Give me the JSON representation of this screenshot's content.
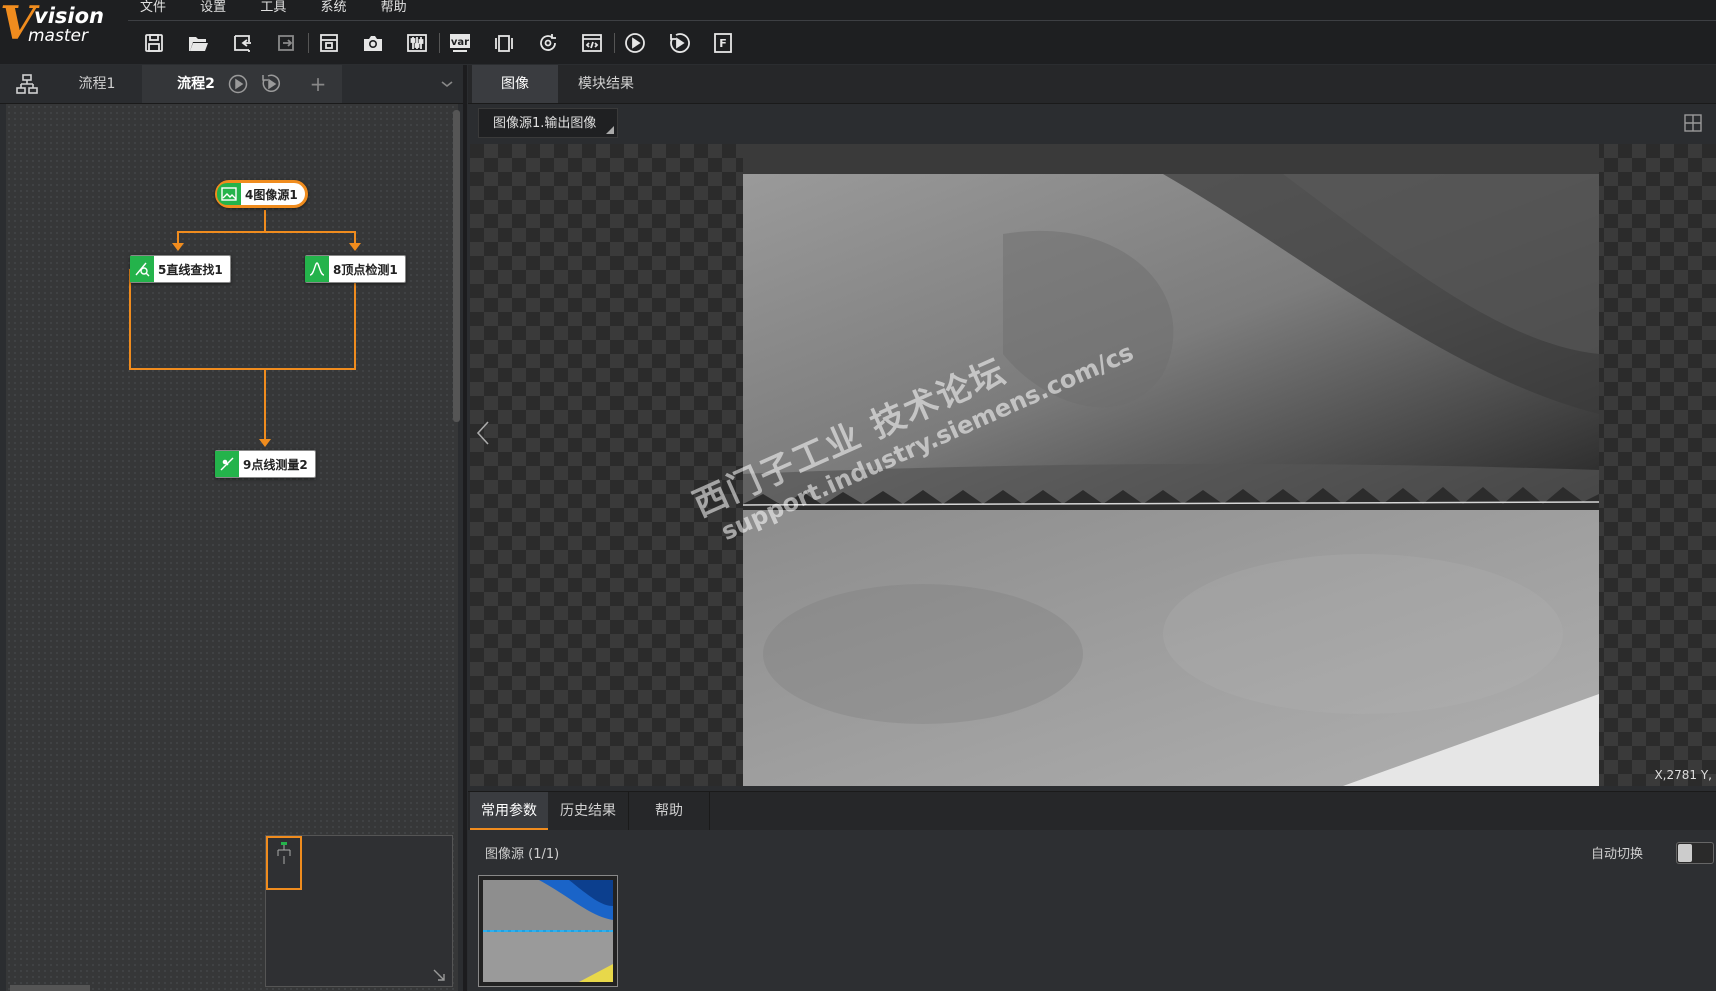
{
  "app": {
    "logo_mark": "V",
    "logo_line1": "vision",
    "logo_line2": "master"
  },
  "menu": [
    "文件",
    "设置",
    "工具",
    "系统",
    "帮助"
  ],
  "toolbar": [
    "save-icon",
    "open-folder-icon",
    "import-icon",
    "export-icon",
    "calculator-icon",
    "camera-icon",
    "sliders-icon",
    "variable-icon",
    "device-icon",
    "refresh-icon",
    "code-icon",
    "run-once-icon",
    "run-loop-icon",
    "f-icon"
  ],
  "toolbar_var_label": "var",
  "toolbar_f_label": "F",
  "left_tabs": {
    "process1": "流程1",
    "process2": "流程2",
    "add": "+"
  },
  "flow": {
    "nodes": [
      {
        "id": "src",
        "label": "4图像源1"
      },
      {
        "id": "line",
        "label": "5直线查找1"
      },
      {
        "id": "peak",
        "label": "8顶点检测1"
      },
      {
        "id": "measure",
        "label": "9点线测量2"
      }
    ]
  },
  "right_tabs": {
    "image": "图像",
    "module_result": "模块结果"
  },
  "image_source_select": "图像源1.输出图像",
  "viewer": {
    "coord": "X,2781  Y,",
    "watermark_line1": "西门子工业 技术论坛",
    "watermark_line2": "support.industry.siemens.com/cs"
  },
  "bottom_tabs": {
    "common_params": "常用参数",
    "history": "历史结果",
    "help": "帮助"
  },
  "bottom": {
    "source_label": "图像源 (1/1)",
    "auto_switch": "自动切换"
  },
  "colors": {
    "accent": "#f08c1e",
    "node_green": "#24b34b",
    "active_tab": "#3a3c40"
  }
}
